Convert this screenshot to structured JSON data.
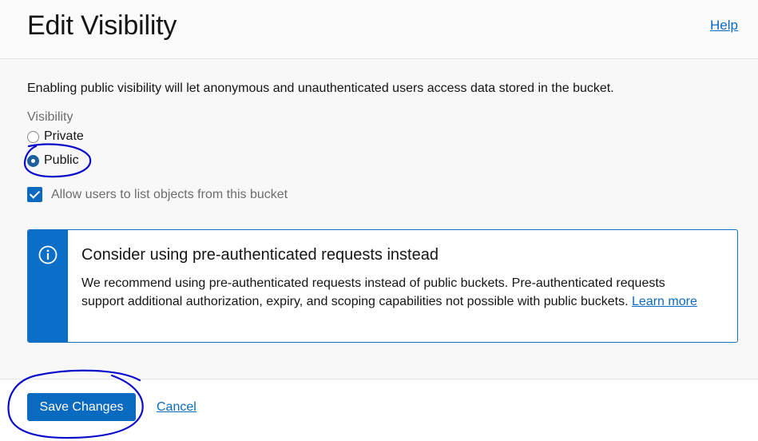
{
  "header": {
    "title": "Edit Visibility",
    "help_label": "Help"
  },
  "body": {
    "intro": "Enabling public visibility will let anonymous and unauthenticated users access data stored in the bucket.",
    "visibility_label": "Visibility",
    "options": [
      {
        "label": "Private",
        "checked": false
      },
      {
        "label": "Public",
        "checked": true
      }
    ],
    "allow_list_label": "Allow users to list objects from this bucket",
    "allow_list_checked": true
  },
  "notice": {
    "title": "Consider using pre-authenticated requests instead",
    "text": "We recommend using pre-authenticated requests instead of public buckets. Pre-authenticated requests support additional authorization, expiry, and scoping capabilities not possible with public buckets.",
    "link_label": "Learn more",
    "icon": "info-icon"
  },
  "footer": {
    "save_label": "Save Changes",
    "cancel_label": "Cancel"
  },
  "colors": {
    "accent": "#0a6ac0",
    "annotation": "#0a0acc"
  }
}
